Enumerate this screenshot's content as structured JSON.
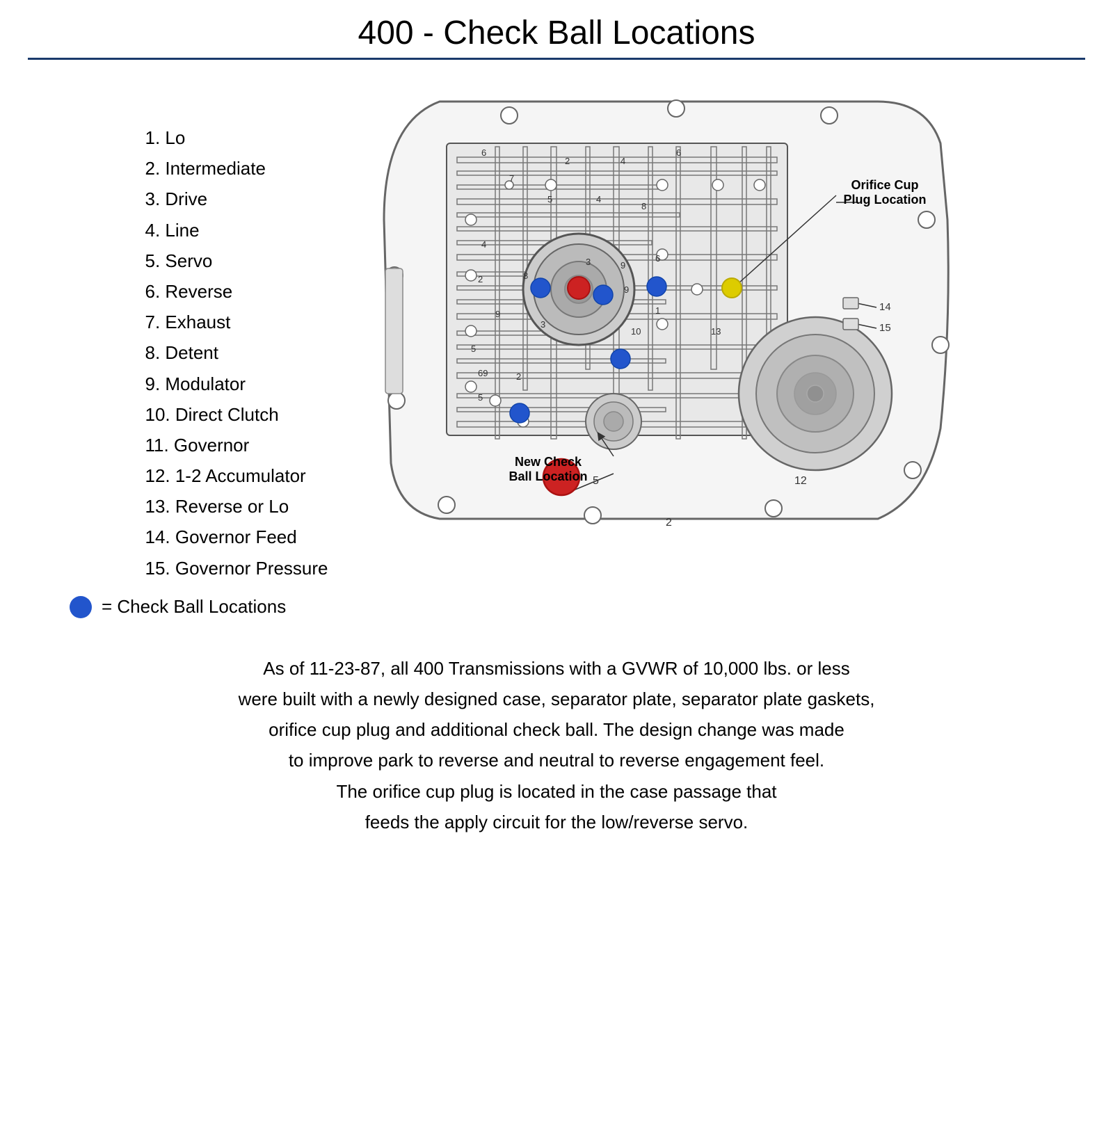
{
  "title": "400 - Check Ball Locations",
  "legend": {
    "items": [
      "1.  Lo",
      "2.  Intermediate",
      "3.  Drive",
      "4.  Line",
      "5.  Servo",
      "6.  Reverse",
      "7.  Exhaust",
      "8.  Detent",
      "9.  Modulator",
      "10. Direct Clutch",
      "11. Governor",
      "12. 1-2 Accumulator",
      "13. Reverse or Lo",
      "14. Governor Feed",
      "15. Governor Pressure"
    ]
  },
  "labels": {
    "orifice_cup": "Orifice Cup\nPlug Location",
    "new_check_ball": "New Check\nBall Location",
    "check_ball_legend": "= Check Ball Locations"
  },
  "description": "As of 11-23-87, all 400 Transmissions with a GVWR of 10,000 lbs. or less\nwere built with a newly designed case, separator plate, separator plate gaskets,\norifice cup plug and additional check ball.  The design change was made\nto improve park to reverse and neutral to reverse engagement feel.\nThe orifice cup plug is located in the case passage that\nfeeds the apply circuit for the low/reverse servo."
}
